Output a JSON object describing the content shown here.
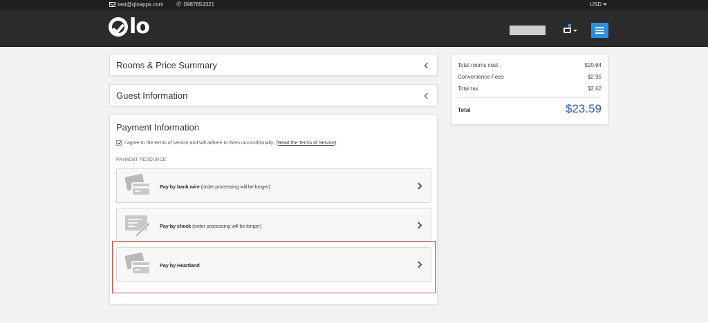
{
  "topbar": {
    "email": "test@qloapps.com",
    "phone": "0987654321",
    "currency": "USD"
  },
  "header": {
    "logo_text": "lo"
  },
  "sections": {
    "rooms_summary_title": "Rooms & Price Summary",
    "guest_info_title": "Guest Information",
    "payment_info_title": "Payment Information"
  },
  "terms": {
    "text": "I agree to the terms of service and will adhere to them unconditionally.",
    "link": "(Read the Terms of Service)",
    "checked": true
  },
  "payment": {
    "resource_label": "PAYMENT RESOURCE",
    "options": [
      {
        "name": "Pay by bank wire",
        "note": "(order processing will be longer)",
        "icon": "bank-wire-card-icon"
      },
      {
        "name": "Pay by check",
        "note": "(order processing will be longer)",
        "icon": "check-pen-icon"
      },
      {
        "name": "Pay by Heartland",
        "note": "",
        "icon": "heartland-card-icon"
      }
    ]
  },
  "summary": {
    "rooms_cost_label": "Total rooms cost",
    "rooms_cost_value": "$20.64",
    "fees_label": "Convenience Fees",
    "fees_value": "$2.95",
    "tax_label": "Total tax",
    "tax_value": "$2.62",
    "total_label": "Total",
    "total_value": "$23.59"
  },
  "colors": {
    "accent": "#2d8ee8",
    "total": "#2a5db0",
    "highlight": "#e03a3a"
  }
}
